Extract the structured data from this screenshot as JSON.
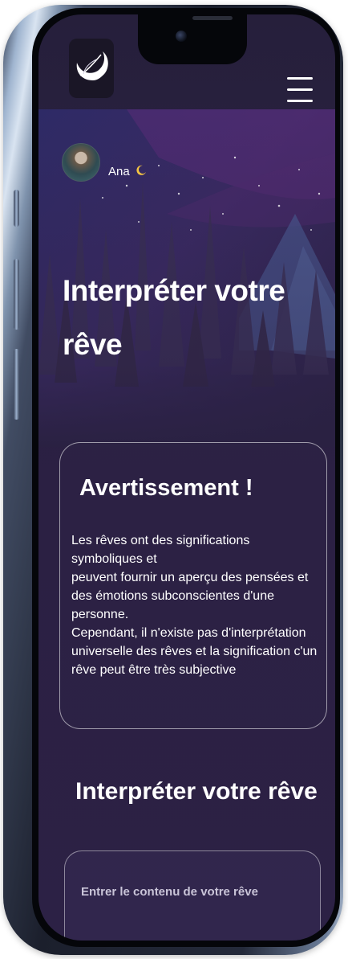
{
  "header": {
    "logo_icon": "moon-feather-logo",
    "menu_icon": "hamburger-menu-icon"
  },
  "profile": {
    "name": "Ana",
    "name_icon": "crescent-moon"
  },
  "hero": {
    "title": "Interpréter votre rêve"
  },
  "warning_card": {
    "title": "Avertissement !",
    "text": "Les rêves ont des significations symboliques et\npeuvent fournir un aperçu des pensées et des émotions subconscientes d'une personne.\nCependant, il n'existe pas d'interprétation universelle des rêves et la signification c'un rêve peut être très subjective"
  },
  "interpret_section": {
    "title": "Interpréter votre rêve",
    "input_placeholder": "Entrer le contenu de votre rêve"
  },
  "colors": {
    "background": "#2b2043",
    "text": "#ffffff",
    "accent_purple": "#5a2c78"
  }
}
